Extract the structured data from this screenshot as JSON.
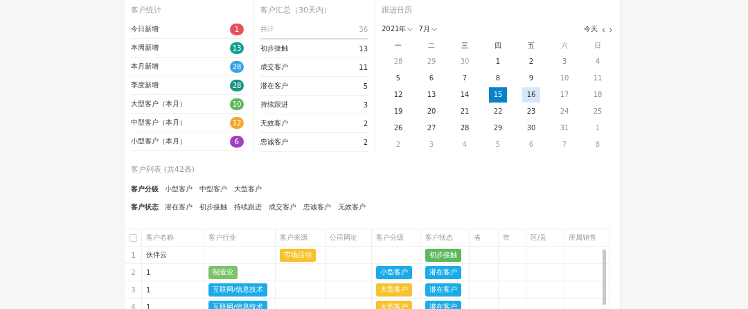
{
  "stats": {
    "title": "客户统计",
    "items": [
      {
        "label": "今日新增",
        "count": "1",
        "color": "#e8505a"
      },
      {
        "label": "本周新增",
        "count": "13",
        "color": "#14a08c"
      },
      {
        "label": "本月新增",
        "count": "28",
        "color": "#3aa0e8"
      },
      {
        "label": "季度新增",
        "count": "28",
        "color": "#1a9484"
      },
      {
        "label": "大型客户（本月）",
        "count": "10",
        "color": "#5cb85c"
      },
      {
        "label": "中型客户（本月）",
        "count": "12",
        "color": "#f5a630"
      },
      {
        "label": "小型客户（本月）",
        "count": "6",
        "color": "#a040c0"
      }
    ]
  },
  "summary": {
    "title": "客户汇总（30天内）",
    "total_label": "共计",
    "total": "36",
    "items": [
      {
        "label": "初步接触",
        "count": "13"
      },
      {
        "label": "成交客户",
        "count": "11"
      },
      {
        "label": "潜在客户",
        "count": "5"
      },
      {
        "label": "持续跟进",
        "count": "3"
      },
      {
        "label": "无效客户",
        "count": "2"
      },
      {
        "label": "忠诚客户",
        "count": "2"
      }
    ]
  },
  "calendar": {
    "title": "跟进日历",
    "year": "2021年",
    "month": "7月",
    "today_button": "今天",
    "prev": "‹",
    "next": "›",
    "weekdays": [
      {
        "label": "一",
        "weekend": false
      },
      {
        "label": "二",
        "weekend": false
      },
      {
        "label": "三",
        "weekend": false
      },
      {
        "label": "四",
        "weekend": false
      },
      {
        "label": "五",
        "weekend": false
      },
      {
        "label": "六",
        "weekend": true
      },
      {
        "label": "日",
        "weekend": true
      }
    ],
    "weeks": [
      [
        {
          "d": "28",
          "muted": true,
          "selected": false,
          "marked": false
        },
        {
          "d": "29",
          "muted": true,
          "selected": false,
          "marked": false
        },
        {
          "d": "30",
          "muted": true,
          "selected": false,
          "marked": false
        },
        {
          "d": "1",
          "muted": false,
          "selected": false,
          "marked": false
        },
        {
          "d": "2",
          "muted": false,
          "selected": false,
          "marked": false
        },
        {
          "d": "3",
          "muted": false,
          "selected": false,
          "marked": false
        },
        {
          "d": "4",
          "muted": false,
          "selected": false,
          "marked": false
        }
      ],
      [
        {
          "d": "5",
          "muted": false,
          "selected": false,
          "marked": false
        },
        {
          "d": "6",
          "muted": false,
          "selected": false,
          "marked": false
        },
        {
          "d": "7",
          "muted": false,
          "selected": false,
          "marked": false
        },
        {
          "d": "8",
          "muted": false,
          "selected": false,
          "marked": false
        },
        {
          "d": "9",
          "muted": false,
          "selected": false,
          "marked": false
        },
        {
          "d": "10",
          "muted": false,
          "selected": false,
          "marked": false
        },
        {
          "d": "11",
          "muted": false,
          "selected": false,
          "marked": false
        }
      ],
      [
        {
          "d": "12",
          "muted": false,
          "selected": false,
          "marked": false
        },
        {
          "d": "13",
          "muted": false,
          "selected": false,
          "marked": false
        },
        {
          "d": "14",
          "muted": false,
          "selected": false,
          "marked": false
        },
        {
          "d": "15",
          "muted": false,
          "selected": true,
          "marked": false
        },
        {
          "d": "16",
          "muted": false,
          "selected": false,
          "marked": true
        },
        {
          "d": "17",
          "muted": false,
          "selected": false,
          "marked": false
        },
        {
          "d": "18",
          "muted": false,
          "selected": false,
          "marked": false
        }
      ],
      [
        {
          "d": "19",
          "muted": false,
          "selected": false,
          "marked": false
        },
        {
          "d": "20",
          "muted": false,
          "selected": false,
          "marked": false
        },
        {
          "d": "21",
          "muted": false,
          "selected": false,
          "marked": false
        },
        {
          "d": "22",
          "muted": false,
          "selected": false,
          "marked": false
        },
        {
          "d": "23",
          "muted": false,
          "selected": false,
          "marked": false
        },
        {
          "d": "24",
          "muted": false,
          "selected": false,
          "marked": false
        },
        {
          "d": "25",
          "muted": false,
          "selected": false,
          "marked": false
        }
      ],
      [
        {
          "d": "26",
          "muted": false,
          "selected": false,
          "marked": false
        },
        {
          "d": "27",
          "muted": false,
          "selected": false,
          "marked": false
        },
        {
          "d": "28",
          "muted": false,
          "selected": false,
          "marked": false
        },
        {
          "d": "29",
          "muted": false,
          "selected": false,
          "marked": false
        },
        {
          "d": "30",
          "muted": false,
          "selected": false,
          "marked": false
        },
        {
          "d": "31",
          "muted": false,
          "selected": false,
          "marked": false
        },
        {
          "d": "1",
          "muted": true,
          "selected": false,
          "marked": false
        }
      ],
      [
        {
          "d": "2",
          "muted": true,
          "selected": false,
          "marked": false
        },
        {
          "d": "3",
          "muted": true,
          "selected": false,
          "marked": false
        },
        {
          "d": "4",
          "muted": true,
          "selected": false,
          "marked": false
        },
        {
          "d": "5",
          "muted": true,
          "selected": false,
          "marked": false
        },
        {
          "d": "6",
          "muted": true,
          "selected": false,
          "marked": false
        },
        {
          "d": "7",
          "muted": true,
          "selected": false,
          "marked": false
        },
        {
          "d": "8",
          "muted": true,
          "selected": false,
          "marked": false
        }
      ]
    ]
  },
  "list": {
    "title": "客户列表 (共42条)",
    "filters": [
      {
        "label": "客户分级",
        "options": [
          "小型客户",
          "中型客户",
          "大型客户"
        ]
      },
      {
        "label": "客户状态",
        "options": [
          "潜在客户",
          "初步接触",
          "持续跟进",
          "成交客户",
          "忠诚客户",
          "无效客户"
        ]
      }
    ],
    "columns": [
      "客户名称",
      "客户行业",
      "客户来源",
      "公司网址",
      "客户分级",
      "客户状态",
      "省",
      "市",
      "区/县",
      "所属销售"
    ],
    "rows": [
      {
        "index": "1",
        "name": "伙伴云",
        "source": {
          "text": "市场活动",
          "color": "#f7c22e"
        },
        "status": {
          "text": "初步接触",
          "color": "#5cb85c"
        }
      },
      {
        "index": "2",
        "name": "1",
        "industry": {
          "text": "制造业",
          "color": "#7cc26b"
        },
        "level": {
          "text": "小型客户",
          "color": "#1aabe8"
        },
        "status": {
          "text": "潜在客户",
          "color": "#1aabe8"
        }
      },
      {
        "index": "3",
        "name": "1",
        "industry": {
          "text": "互联网/信息技术",
          "color": "#1aabe8"
        },
        "level": {
          "text": "大型客户",
          "color": "#f7c22e"
        },
        "status": {
          "text": "潜在客户",
          "color": "#1aabe8"
        }
      },
      {
        "index": "4",
        "name": "1",
        "industry": {
          "text": "互联网/信息技术",
          "color": "#1aabe8"
        },
        "level": {
          "text": "大型客户",
          "color": "#f7c22e"
        },
        "status": {
          "text": "潜在客户",
          "color": "#1aabe8"
        }
      }
    ],
    "all_checked": false
  }
}
